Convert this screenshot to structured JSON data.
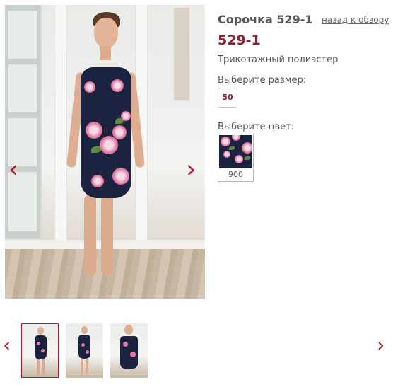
{
  "product": {
    "title": "Сорочка 529-1",
    "back_link": "назад к обзору",
    "article": "529-1",
    "material": "Трикотажный полиэстер"
  },
  "size": {
    "label": "Выберите размер:",
    "options": [
      "50"
    ]
  },
  "color": {
    "label": "Выберите цвет:",
    "options": [
      {
        "code": "900",
        "swatch": "navy-floral"
      }
    ]
  },
  "gallery": {
    "prev_icon": "‹",
    "next_icon": "›",
    "thumbnails": [
      {
        "name": "front",
        "active": true
      },
      {
        "name": "front-side",
        "active": false
      },
      {
        "name": "closeup",
        "active": false
      }
    ]
  },
  "colors": {
    "accent": "#b01c2e",
    "article": "#8a2433",
    "dress": "#1c2340"
  }
}
